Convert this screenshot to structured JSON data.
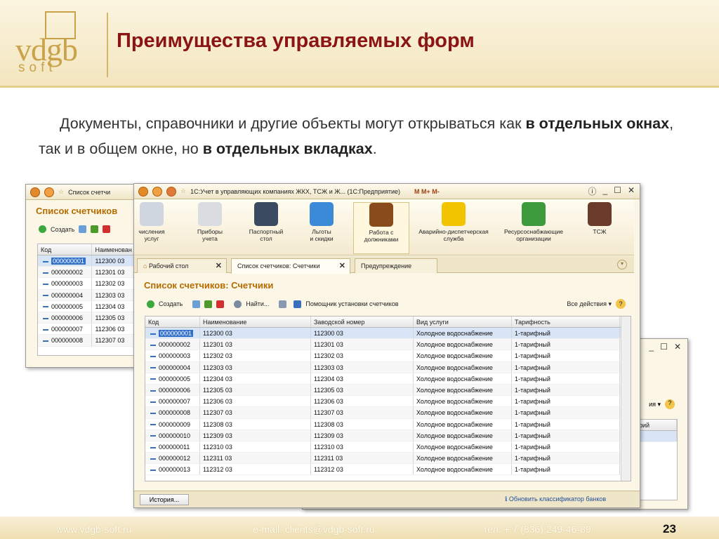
{
  "slide": {
    "title": "Преимущества управляемых форм",
    "text_parts": [
      "Документы, справочники и другие объекты могут открываться как ",
      "в отдельных окнах",
      ", так и в общем окне, но ",
      "в отдельных вкладках",
      "."
    ],
    "logo_main": "vdgb",
    "logo_sub": "soft",
    "footer": {
      "site": "www.vdgb-soft.ru",
      "email": "e-mail: clients@vdgb-soft.ru",
      "phone": "тел. + 7 (836) 249-46-89",
      "page": "23"
    }
  },
  "back_window": {
    "tab_title": "Список счетчи",
    "section": "Список счетчиков",
    "create": "Создать",
    "col_code": "Код",
    "col_name": "Наименован",
    "rows": [
      [
        "000000001",
        "112300 03"
      ],
      [
        "000000002",
        "112301 03"
      ],
      [
        "000000003",
        "112302 03"
      ],
      [
        "000000004",
        "112303 03"
      ],
      [
        "000000005",
        "112304 03"
      ],
      [
        "000000006",
        "112305 03"
      ],
      [
        "000000007",
        "112306 03"
      ],
      [
        "000000008",
        "112307 03"
      ]
    ]
  },
  "right_window": {
    "all_actions": "ия",
    "col": "рий"
  },
  "main_window": {
    "title": "1С:Учет в управляющих компаниях ЖКХ, ТСЖ и Ж...  (1С:Предприятие)",
    "title_tools": "M  M+  M-",
    "ribbon": [
      {
        "label": "числения\nуслуг",
        "icon": "calculator-icon",
        "color": "#cfd6df"
      },
      {
        "label": "Приборы\nучета",
        "icon": "gauge-icon",
        "color": "#d9dde2"
      },
      {
        "label": "Паспортный\nстол",
        "icon": "passport-icon",
        "color": "#3a4a60"
      },
      {
        "label": "Льготы\nи скидки",
        "icon": "chart-icon",
        "color": "#3b8ad8"
      },
      {
        "label": "Работа с\nдолжниками",
        "icon": "gavel-icon",
        "color": "#8a4b1c"
      },
      {
        "label": "Аварийно-диспетчерская\nслужба",
        "icon": "helmet-icon",
        "color": "#f2c400"
      },
      {
        "label": "Ресурсоснабжающие\nорганизации",
        "icon": "building-icon",
        "color": "#3c9a3c"
      },
      {
        "label": "ТСЖ",
        "icon": "people-icon",
        "color": "#6a3a2a"
      }
    ],
    "tabs": [
      "Рабочий стол",
      "Список счетчиков: Счетчики",
      "Предупреждение"
    ],
    "section": "Список счетчиков: Счетчики",
    "toolbar": {
      "create": "Создать",
      "find": "Найти...",
      "helper": "Помощник установки счетчиков",
      "all_actions": "Все действия"
    },
    "columns": [
      "Код",
      "Наименование",
      "Заводской номер",
      "Вид услуги",
      "Тарифность"
    ],
    "rows": [
      [
        "000000001",
        "112300 03",
        "112300 03",
        "Холодное водоснабжение",
        "1-тарифный"
      ],
      [
        "000000002",
        "112301 03",
        "112301 03",
        "Холодное водоснабжение",
        "1-тарифный"
      ],
      [
        "000000003",
        "112302 03",
        "112302 03",
        "Холодное водоснабжение",
        "1-тарифный"
      ],
      [
        "000000004",
        "112303 03",
        "112303 03",
        "Холодное водоснабжение",
        "1-тарифный"
      ],
      [
        "000000005",
        "112304 03",
        "112304 03",
        "Холодное водоснабжение",
        "1-тарифный"
      ],
      [
        "000000006",
        "112305 03",
        "112305 03",
        "Холодное водоснабжение",
        "1-тарифный"
      ],
      [
        "000000007",
        "112306 03",
        "112306 03",
        "Холодное водоснабжение",
        "1-тарифный"
      ],
      [
        "000000008",
        "112307 03",
        "112307 03",
        "Холодное водоснабжение",
        "1-тарифный"
      ],
      [
        "000000009",
        "112308 03",
        "112308 03",
        "Холодное водоснабжение",
        "1-тарифный"
      ],
      [
        "000000010",
        "112309 03",
        "112309 03",
        "Холодное водоснабжение",
        "1-тарифный"
      ],
      [
        "000000011",
        "112310 03",
        "112310 03",
        "Холодное водоснабжение",
        "1-тарифный"
      ],
      [
        "000000012",
        "112311 03",
        "112311 03",
        "Холодное водоснабжение",
        "1-тарифный"
      ],
      [
        "000000013",
        "112312 03",
        "112312 03",
        "Холодное водоснабжение",
        "1-тарифный"
      ]
    ],
    "history": "История...",
    "bank_link": "Обновить классификатор банков"
  }
}
